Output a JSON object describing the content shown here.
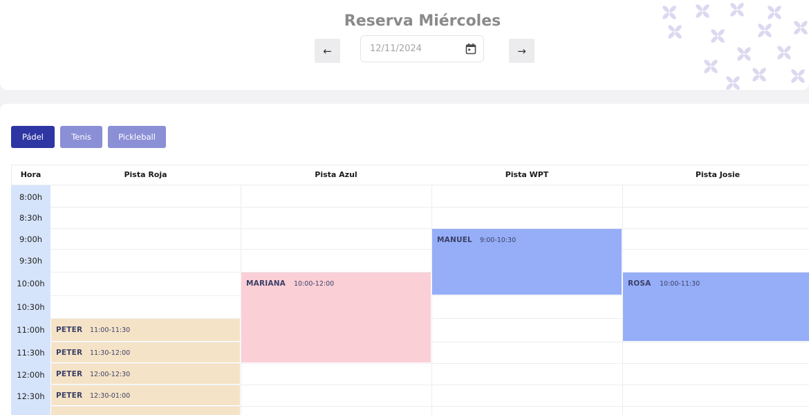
{
  "header": {
    "title": "Reserva Miércoles",
    "prev_arrow": "←",
    "next_arrow": "→",
    "date_value": "12/11/2024"
  },
  "sports": [
    {
      "label": "Pádel",
      "active": true
    },
    {
      "label": "Tenis",
      "active": false
    },
    {
      "label": "Pickleball",
      "active": false
    }
  ],
  "table": {
    "hour_header": "Hora",
    "courts": [
      "Pista Roja",
      "Pista Azul",
      "Pista WPT",
      "Pista Josie"
    ],
    "hours": [
      "8:00h",
      "8:30h",
      "9:00h",
      "9:30h",
      "10:00h",
      "10:30h",
      "11:00h",
      "11:30h",
      "12:00h",
      "12:30h"
    ]
  },
  "bookings": [
    {
      "court": "Pista Roja",
      "name": "PETER",
      "time": "11:00-11:30"
    },
    {
      "court": "Pista Roja",
      "name": "PETER",
      "time": "11:30-12:00"
    },
    {
      "court": "Pista Roja",
      "name": "PETER",
      "time": "12:00-12:30"
    },
    {
      "court": "Pista Roja",
      "name": "PETER",
      "time": "12:30-01:00"
    },
    {
      "court": "Pista Azul",
      "name": "MARIANA",
      "time": "10:00-12:00"
    },
    {
      "court": "Pista WPT",
      "name": "MANUEL",
      "time": "9:00-10:30"
    },
    {
      "court": "Pista Josie",
      "name": "ROSA",
      "time": "10:00-11:30"
    }
  ],
  "colors": {
    "tab_active": "#2e36a3",
    "tab_inactive": "#8b8fd6",
    "hour_column": "#d6e4fb",
    "booking_peter": "#f5e3c7",
    "booking_mariana": "#fbcfd6",
    "booking_blue": "#96aef8",
    "decor_pattern": "#d9d6ef"
  },
  "icons": {
    "date_picker": "calendar-icon",
    "prev": "arrow-left-icon",
    "next": "arrow-right-icon"
  }
}
